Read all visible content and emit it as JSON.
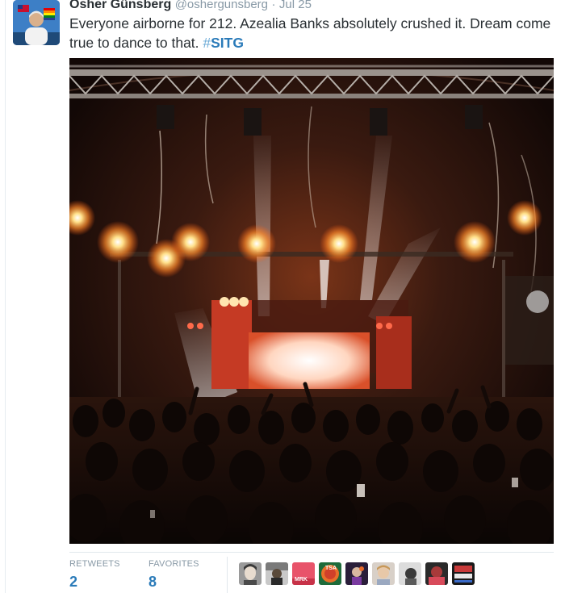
{
  "tweet": {
    "fullname": "Osher Günsberg",
    "username": "@oshergunsberg",
    "separator": "·",
    "time": "Jul 25",
    "text_main": "Everyone airborne for 212. Azealia Banks absolutely crushed it. Dream come true to dance to that. ",
    "hashtag_symbol": "#",
    "hashtag": "SITG",
    "media_alt": "Concert crowd with stage lights"
  },
  "stats": {
    "retweets_label": "RETWEETS",
    "retweets_count": "2",
    "favorites_label": "FAVORITES",
    "favorites_count": "8"
  },
  "favoriters": [
    {
      "name": "favoriter-avatar-1",
      "tag": ""
    },
    {
      "name": "favoriter-avatar-2",
      "tag": ""
    },
    {
      "name": "favoriter-avatar-3",
      "tag": "MRK"
    },
    {
      "name": "favoriter-avatar-4",
      "tag": "TSA"
    },
    {
      "name": "favoriter-avatar-5",
      "tag": ""
    },
    {
      "name": "favoriter-avatar-6",
      "tag": ""
    },
    {
      "name": "favoriter-avatar-7",
      "tag": ""
    },
    {
      "name": "favoriter-avatar-8",
      "tag": ""
    },
    {
      "name": "favoriter-avatar-9",
      "tag": ""
    }
  ],
  "colors": {
    "link": "#2b7bb9",
    "muted": "#8899a6",
    "text": "#292f33"
  }
}
